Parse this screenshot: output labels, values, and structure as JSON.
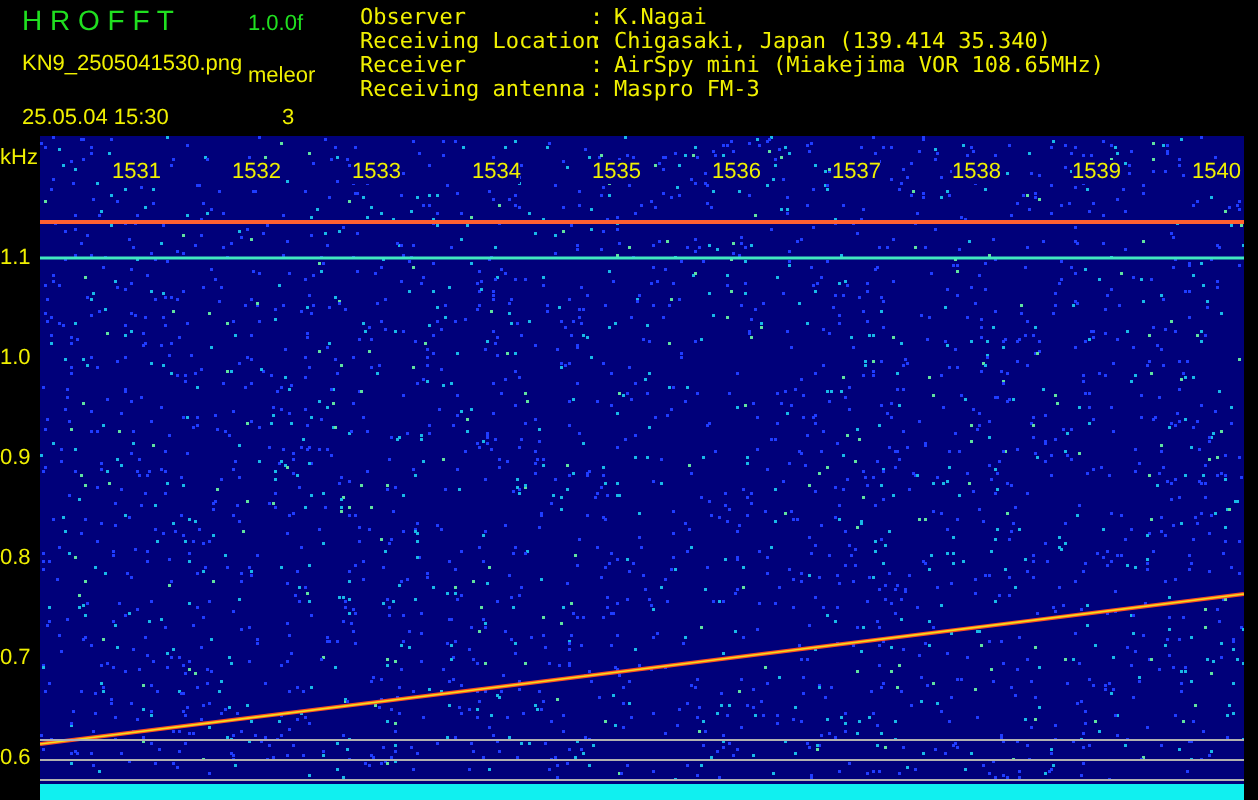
{
  "header": {
    "title": "H R O F F T",
    "version": "1.0.0f",
    "filename": "KN9_2505041530.png",
    "mode": "meleor",
    "datetime": "25.05.04 15:30",
    "count": "3"
  },
  "info": [
    {
      "label": "Observer",
      "separator": ":",
      "value": "K.Nagai"
    },
    {
      "label": "Receiving Location",
      "separator": ":",
      "value": "Chigasaki, Japan (139.414 35.340)"
    },
    {
      "label": "Receiver",
      "separator": ":",
      "value": "AirSpy mini (Miakejima VOR 108.65MHz)"
    },
    {
      "label": "Receiving antenna",
      "separator": ":",
      "value": "Maspro FM-3"
    }
  ],
  "spectrogram": {
    "unit": "kHz",
    "frequency_labels": [
      "1.1",
      "1.0",
      "0.9",
      "0.8",
      "0.7",
      "0.6"
    ],
    "time_labels": [
      "1531",
      "1532",
      "1533",
      "1534",
      "1535",
      "1536",
      "1537",
      "1538",
      "1539",
      "1540"
    ]
  }
}
